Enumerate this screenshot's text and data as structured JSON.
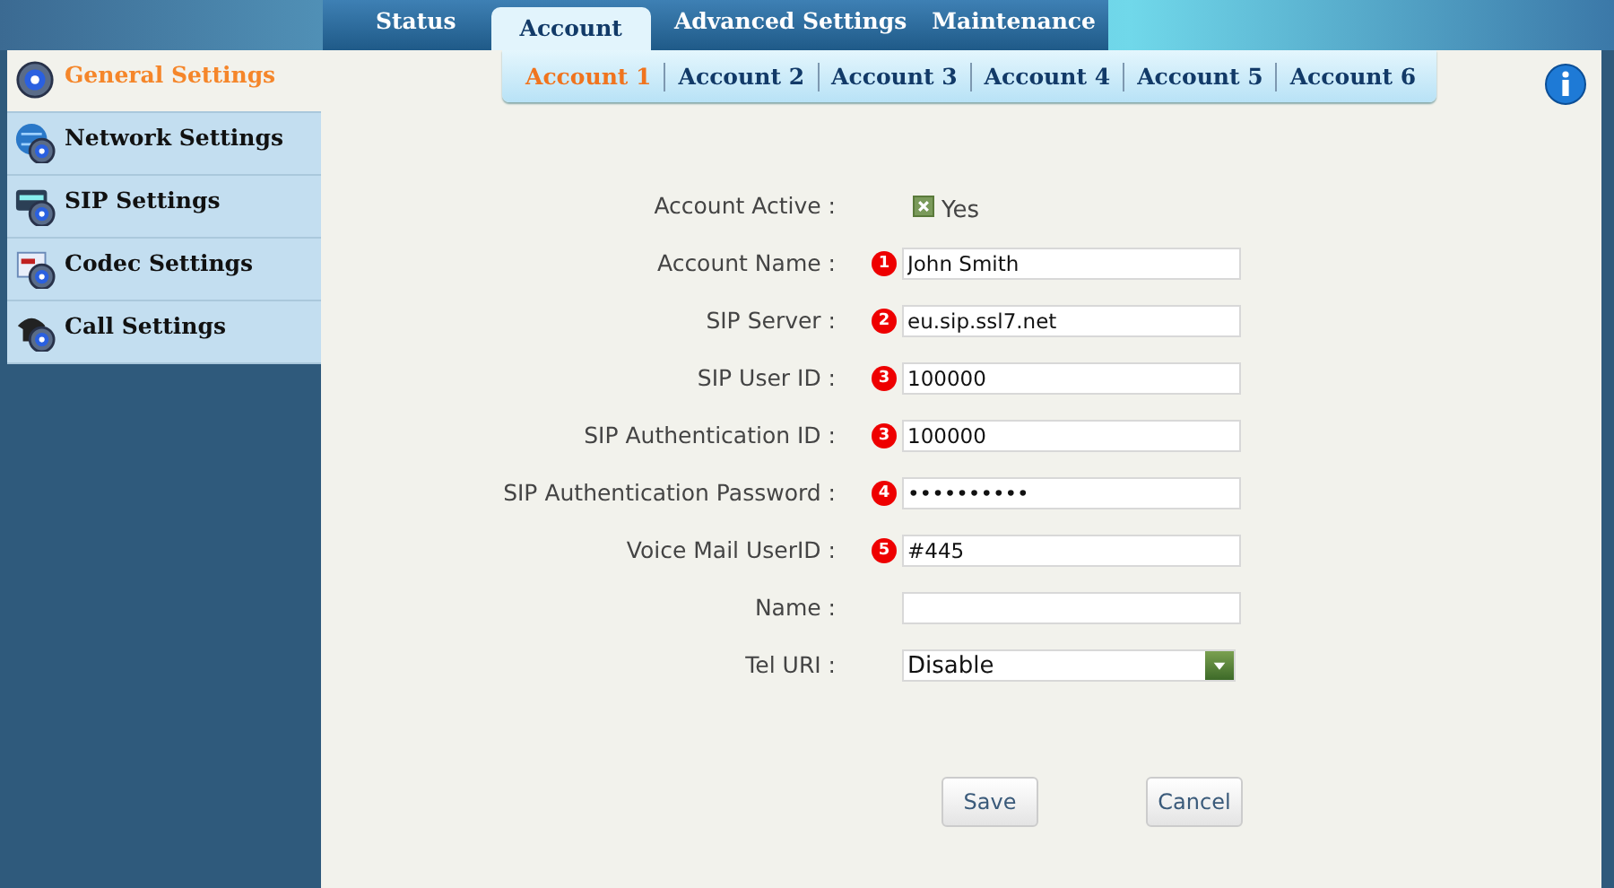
{
  "main_tabs": [
    {
      "label": "Status",
      "selected": false
    },
    {
      "label": "Account",
      "selected": true
    },
    {
      "label": "Advanced Settings",
      "selected": false
    },
    {
      "label": "Maintenance",
      "selected": false
    }
  ],
  "sub_tabs": [
    {
      "label": "Account 1",
      "selected": true
    },
    {
      "label": "Account 2",
      "selected": false
    },
    {
      "label": "Account 3",
      "selected": false
    },
    {
      "label": "Account 4",
      "selected": false
    },
    {
      "label": "Account 5",
      "selected": false
    },
    {
      "label": "Account 6",
      "selected": false
    }
  ],
  "sidebar": {
    "items": [
      {
        "label": "General Settings",
        "selected": true
      },
      {
        "label": "Network Settings",
        "selected": false
      },
      {
        "label": "SIP Settings",
        "selected": false
      },
      {
        "label": "Codec Settings",
        "selected": false
      },
      {
        "label": "Call Settings",
        "selected": false
      }
    ]
  },
  "form": [
    {
      "kind": "checkbox",
      "label": "Account Active :",
      "checked": true,
      "text": "Yes"
    },
    {
      "kind": "text",
      "label": "Account Name :",
      "badge": "1",
      "value": "John Smith"
    },
    {
      "kind": "text",
      "label": "SIP Server :",
      "badge": "2",
      "value": "eu.sip.ssl7.net"
    },
    {
      "kind": "text",
      "label": "SIP User ID :",
      "badge": "3",
      "value": "100000"
    },
    {
      "kind": "text",
      "label": "SIP Authentication ID :",
      "badge": "3",
      "value": "100000"
    },
    {
      "kind": "text",
      "label": "SIP Authentication Password :",
      "badge": "4",
      "value": "••••••••••"
    },
    {
      "kind": "text",
      "label": "Voice Mail UserID :",
      "badge": "5",
      "value": "#445"
    },
    {
      "kind": "text",
      "label": "Name :"
    },
    {
      "kind": "select",
      "label": "Tel URI :",
      "value": "Disable"
    }
  ],
  "buttons": [
    "Save",
    "Cancel"
  ]
}
